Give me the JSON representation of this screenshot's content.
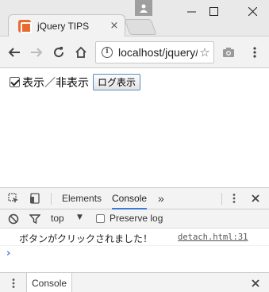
{
  "browser": {
    "tab": {
      "title": "jQuery TIPS",
      "close_icon": "×",
      "favicon": "xampp-favicon-icon"
    },
    "address_bar": {
      "url": "localhost/jquery/detach.html",
      "star_icon": "☆"
    },
    "accent_color": "#e96a2e"
  },
  "page": {
    "checkbox": {
      "checked": true,
      "label": "表示／非表示"
    },
    "log_button": {
      "label": "ログ表示"
    }
  },
  "devtools": {
    "tabs": [
      {
        "label": "Elements",
        "active": false
      },
      {
        "label": "Console",
        "active": true
      }
    ],
    "more_tabs": "»",
    "context": "top",
    "context_arrow": "▼",
    "preserve_log": {
      "label": "Preserve log",
      "checked": false
    },
    "messages": [
      {
        "text": "ボタンがクリックされました！",
        "source": "detach.html:31"
      }
    ],
    "prompt": "›",
    "drawer": {
      "tab_label": "Console",
      "close_icon": "×"
    },
    "close_icon": "×",
    "accent_color": "#3879d9"
  }
}
